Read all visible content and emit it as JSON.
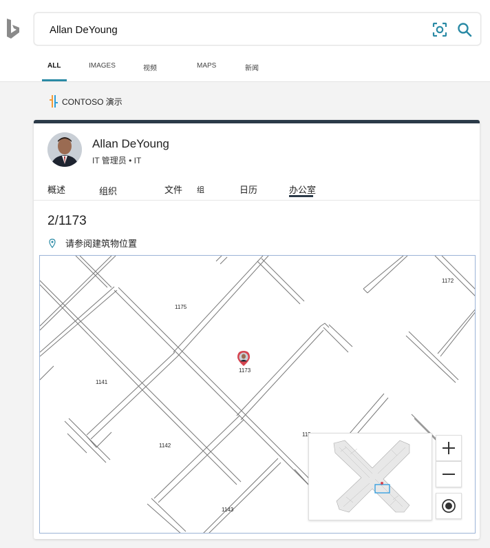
{
  "search": {
    "query": "Allan DeYoung"
  },
  "nav_tabs": [
    {
      "label": "ALL",
      "active": true
    },
    {
      "label": "IMAGES"
    },
    {
      "label": "视频"
    },
    {
      "label": "MAPS"
    },
    {
      "label": "新闻"
    }
  ],
  "org": {
    "name": "CONTOSO 演示"
  },
  "person": {
    "name": "Allan DeYoung",
    "title": "IT 管理员 • IT"
  },
  "card_tabs": [
    {
      "label": "概述"
    },
    {
      "label": "组织"
    },
    {
      "label": "文件"
    },
    {
      "label": "组"
    },
    {
      "label": "日历"
    },
    {
      "label": "办公室",
      "active": true
    }
  ],
  "office": {
    "room": "2/1173",
    "location_link": "请参阅建筑物位置"
  },
  "map": {
    "rooms": [
      "1172",
      "1175",
      "1173",
      "1141",
      "1142",
      "1143",
      "115"
    ],
    "marker_room": "1173"
  },
  "icons": {
    "logo": "bing-logo-icon",
    "visual_search": "visual-search-icon",
    "search": "search-icon",
    "org_logo": "contoso-logo-icon",
    "location": "location-pin-icon",
    "map_marker": "map-marker-icon",
    "zoom_in": "plus-icon",
    "zoom_out": "minus-icon",
    "locate": "locate-me-icon"
  },
  "colors": {
    "accent": "#2a8aa5",
    "card_top": "#2b3a48",
    "marker": "#d64550",
    "minimap_highlight": "#2b9be0"
  }
}
